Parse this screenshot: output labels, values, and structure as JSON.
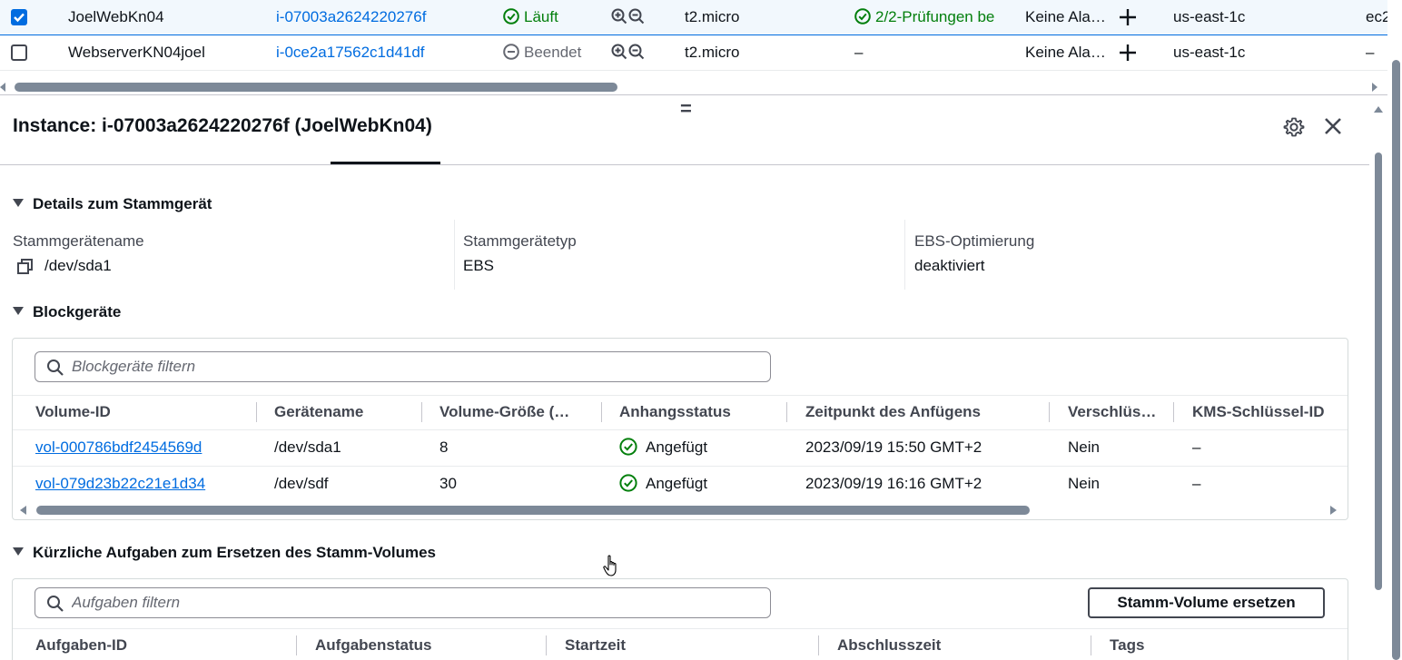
{
  "instances": [
    {
      "selected": true,
      "name": "JoelWebKn04",
      "id": "i-07003a2624220276f",
      "state": "Läuft",
      "state_icon": "check-circle-icon",
      "type": "t2.micro",
      "checks": "2/2-Prüfungen be",
      "alarm": "Keine Ala…",
      "zone": "us-east-1c",
      "dns": "ec2"
    },
    {
      "selected": false,
      "name": "WebserverKN04joel",
      "id": "i-0ce2a17562c1d41df",
      "state": "Beendet",
      "state_icon": "minus-circle-icon",
      "type": "t2.micro",
      "checks": "–",
      "alarm": "Keine Ala…",
      "zone": "us-east-1c",
      "dns": "–"
    }
  ],
  "panel": {
    "title": "Instance: i-07003a2624220276f (JoelWebKn04)",
    "drag_handle": "="
  },
  "root_device": {
    "section_title": "Details zum Stammgerät",
    "fields": [
      {
        "label": "Stammgerätename",
        "value": "/dev/sda1"
      },
      {
        "label": "Stammgerätetyp",
        "value": "EBS"
      },
      {
        "label": "EBS-Optimierung",
        "value": "deaktiviert"
      }
    ]
  },
  "block_devices": {
    "section_title": "Blockgeräte",
    "filter_placeholder": "Blockgeräte filtern",
    "columns": [
      "Volume-ID",
      "Gerätename",
      "Volume-Größe (…",
      "Anhangsstatus",
      "Zeitpunkt des Anfügens",
      "Verschlüs…",
      "KMS-Schlüssel-ID"
    ],
    "rows": [
      [
        "vol-000786bdf2454569d",
        "/dev/sda1",
        "8",
        "Angefügt",
        "2023/09/19 15:50 GMT+2",
        "Nein",
        "–"
      ],
      [
        "vol-079d23b22c21e1d34",
        "/dev/sdf",
        "30",
        "Angefügt",
        "2023/09/19 16:16 GMT+2",
        "Nein",
        "–"
      ]
    ]
  },
  "replace_tasks": {
    "section_title": "Kürzliche Aufgaben zum Ersetzen des Stamm-Volumes",
    "filter_placeholder": "Aufgaben filtern",
    "replace_button": "Stamm-Volume ersetzen",
    "columns": [
      "Aufgaben-ID",
      "Aufgabenstatus",
      "Startzeit",
      "Abschlusszeit",
      "Tags"
    ]
  },
  "colors": {
    "link": "#006ce0",
    "success": "#037f0c",
    "text": "#0f141a",
    "muted": "#656871"
  }
}
